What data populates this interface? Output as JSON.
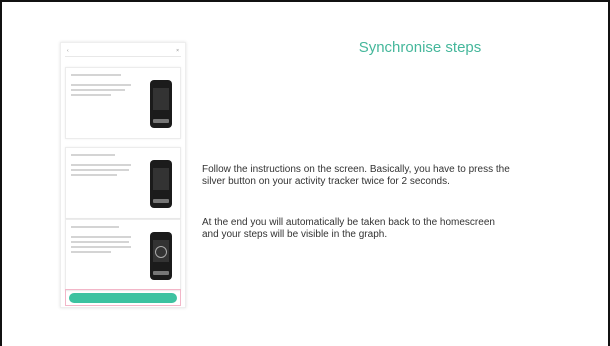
{
  "slide": {
    "title": "Synchronise steps",
    "paragraph_1": "Follow the instructions on the screen. Basically, you have to press the\nsilver button on your activity tracker twice for 2 seconds.",
    "paragraph_2": "At the end you will automatically be taken back to the homescreen\nand your steps will be visible in the graph."
  },
  "colors": {
    "accent": "#45b79b",
    "button": "#3cc2a0",
    "highlight": "#f2b6c8"
  }
}
